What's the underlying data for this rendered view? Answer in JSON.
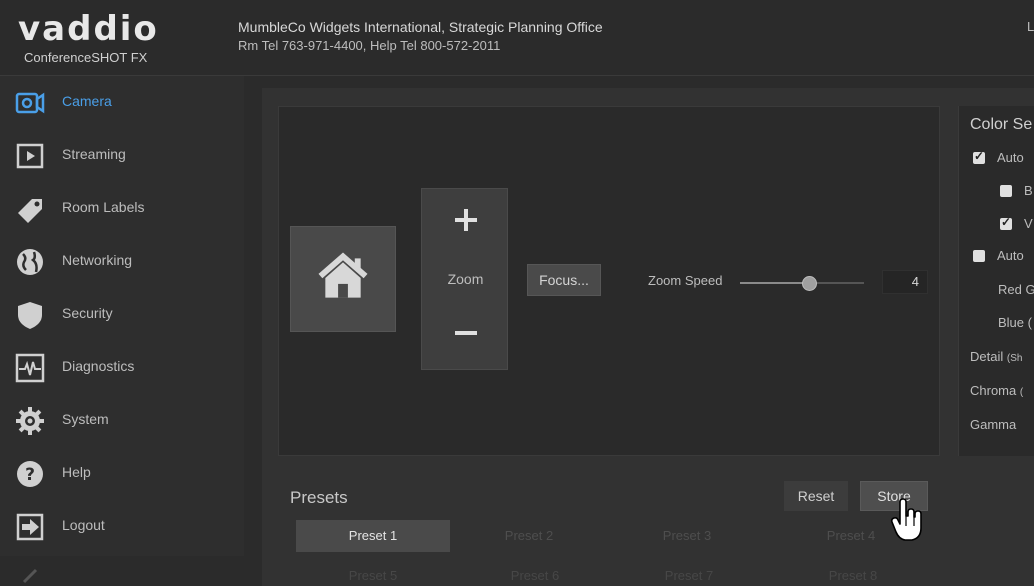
{
  "header": {
    "logo_text": "vaddio",
    "product": "ConferenceSHOT FX",
    "organization": "MumbleCo Widgets International, Strategic Planning Office",
    "phones": "Rm Tel 763-971-4400, Help Tel 800-572-2011",
    "right_text": "L"
  },
  "sidebar": {
    "items": [
      {
        "label": "Camera",
        "icon": "camera-icon",
        "active": true
      },
      {
        "label": "Streaming",
        "icon": "play-icon"
      },
      {
        "label": "Room Labels",
        "icon": "tag-icon"
      },
      {
        "label": "Networking",
        "icon": "globe-icon"
      },
      {
        "label": "Security",
        "icon": "shield-icon"
      },
      {
        "label": "Diagnostics",
        "icon": "pulse-icon"
      },
      {
        "label": "System",
        "icon": "gear-icon"
      },
      {
        "label": "Help",
        "icon": "help-icon"
      },
      {
        "label": "Logout",
        "icon": "logout-icon"
      }
    ]
  },
  "controls": {
    "zoom_label": "Zoom",
    "zoom_plus": "+",
    "zoom_minus": "−",
    "focus_label": "Focus...",
    "zoom_speed_label": "Zoom Speed",
    "zoom_speed_value": "4"
  },
  "color_settings": {
    "title": "Color Se",
    "auto_wb": {
      "label": "Auto",
      "checked": true
    },
    "option_b": {
      "label": "B",
      "checked": false
    },
    "option_w": {
      "label": "V",
      "checked": true
    },
    "auto_iris": {
      "label": "Auto",
      "checked": false
    },
    "red_label": "Red G",
    "blue_label": "Blue (",
    "detail_label": "Detail",
    "detail_suffix": "(Sh",
    "chroma_label": "Chroma",
    "chroma_suffix": "(",
    "gamma_label": "Gamma"
  },
  "presets": {
    "title": "Presets",
    "reset_label": "Reset",
    "store_label": "Store",
    "items": [
      "Preset 1",
      "Preset 2",
      "Preset 3",
      "Preset 4",
      "Preset 5",
      "Preset 6",
      "Preset 7",
      "Preset 8"
    ],
    "selected_index": 0
  },
  "colors": {
    "accent": "#4a9fe8",
    "background": "#2b2b2b",
    "panel": "#2a2a2a"
  }
}
